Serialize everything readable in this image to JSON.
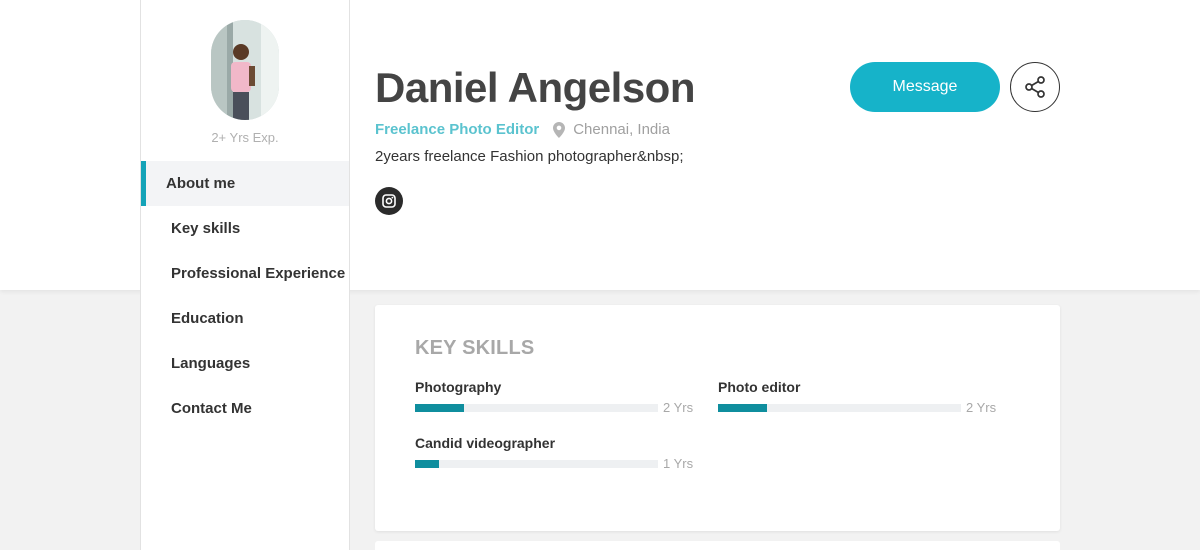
{
  "profile": {
    "experience": "2+ Yrs Exp.",
    "name": "Daniel Angelson",
    "role": "Freelance Photo Editor",
    "location": "Chennai, India",
    "bio": "2years freelance Fashion photographer&nbsp;"
  },
  "actions": {
    "message_label": "Message"
  },
  "nav": {
    "items": [
      {
        "label": "About me",
        "active": true
      },
      {
        "label": "Key skills"
      },
      {
        "label": "Professional Experience"
      },
      {
        "label": "Education"
      },
      {
        "label": "Languages"
      },
      {
        "label": "Contact Me"
      }
    ]
  },
  "key_skills": {
    "title": "KEY SKILLS",
    "skills": [
      {
        "name": "Photography",
        "years": "2 Yrs",
        "level": 0.2
      },
      {
        "name": "Photo editor",
        "years": "2 Yrs",
        "level": 0.2
      },
      {
        "name": "Candid videographer",
        "years": "1 Yrs",
        "level": 0.1
      }
    ]
  },
  "icons": [
    "location-pin-icon",
    "instagram-icon",
    "share-icon",
    "avatar-photo"
  ],
  "colors": {
    "accent": "#16b3c9",
    "role_text": "#5bc3cf",
    "bar_fill": "#0f8e9e",
    "nav_active": "#14a3b8"
  }
}
